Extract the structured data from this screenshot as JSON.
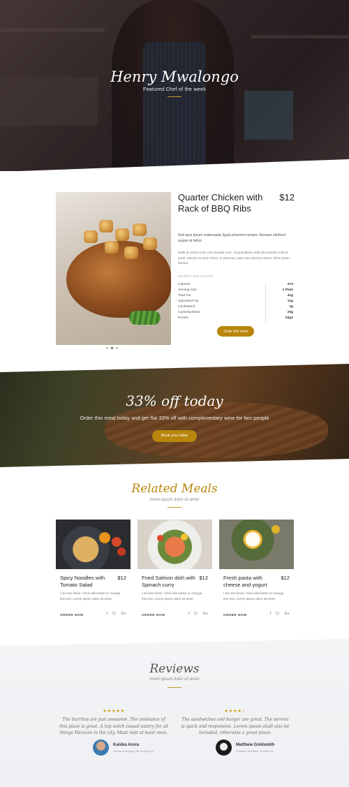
{
  "hero": {
    "chef_name": "Henry Mwalongo",
    "subtitle": "Featured Chef of the week"
  },
  "meal": {
    "title": "Quarter Chicken with Rack of BBQ Ribs",
    "price": "$12",
    "description_lead": "Sed quis ipsum malesuada ligula pharetra tempor. Aenean eleifend augue at tellus.",
    "description_body": "Nulla at varius urna, non suscipit nunc. Suspendisse vehicula suscipit nulla id porta. Mauris eu enim lorem. In pharetra, justo nec pulvinar varius, tellus quam laoreet.",
    "nutrition_title": "NUTRITION FACTS",
    "nutrition": [
      {
        "label": "Calories",
        "value": "670"
      },
      {
        "label": "Serving Size",
        "value": "1 Plate"
      },
      {
        "label": "Total Fat",
        "value": "42g"
      },
      {
        "label": "Saturated Fat",
        "value": "12g"
      },
      {
        "label": "Cholesterol",
        "value": "3g"
      },
      {
        "label": "Carbohydrates",
        "value": "20g"
      },
      {
        "label": "Protein",
        "value": "64g2"
      }
    ],
    "order_button": "Order this meal"
  },
  "promo": {
    "title": "33% off today",
    "subtitle": "Order this meal today and get flat 33% off with complimentary wine for two people",
    "button": "Book your table"
  },
  "related": {
    "title": "Related Meals",
    "subtitle": "lorem ipsum dolor sit amet",
    "cards": [
      {
        "name": "Spicy Noodles with Tomato Salad",
        "price": "$12",
        "text": "I am text block. Click edit button to change this text. Lorem ipsum dolor sit amet",
        "order": "ORDER NOW"
      },
      {
        "name": "Fried Salmon dish with Spinach curry",
        "price": "$12",
        "text": "I am text block. Click edit button to change this text. Lorem ipsum dolor sit amet",
        "order": "ORDER NOW"
      },
      {
        "name": "Fresh pasta with cheese and yogurt",
        "price": "$12",
        "text": "I am text block. Click edit button to change this text. Lorem ipsum dolor sit amet",
        "order": "ORDER NOW"
      }
    ],
    "social_icons": [
      "facebook-icon",
      "twitter-icon",
      "google-plus-icon"
    ]
  },
  "reviews": {
    "title": "Reviews",
    "subtitle": "lorem ipsum dolor sit amet",
    "items": [
      {
        "stars": "★★★★★",
        "quote": "The burritos are just awesome. The ambiance of this place is great. A top notch casual eatery for all things Mexican in the city. Must visit at least once.",
        "name": "Kanika Arora",
        "role": "Interior Designer, We Design Ltd"
      },
      {
        "stars": "★★★★☆",
        "quote": "The sandwiches and burger are great. The service is quick and responsive. Lorem ipsum shall also be included, otherwise a great place.",
        "name": "Matthew Goldsmith",
        "role": "Software Architect, Doodle Inc"
      }
    ]
  },
  "colors": {
    "accent": "#b8860b",
    "text_dark": "#222222",
    "reviews_bg": "#f1f2f5"
  }
}
